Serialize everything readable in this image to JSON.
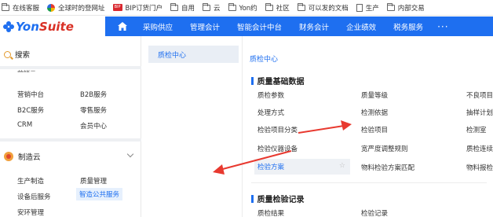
{
  "bookmarks": [
    {
      "label": "在线客服",
      "icon": "folder-icon"
    },
    {
      "label": "全球时的登网址",
      "icon": "pinwheel-icon"
    },
    {
      "label": "BIP订货门户",
      "icon": "bip-icon"
    },
    {
      "label": "自用",
      "icon": "folder-icon"
    },
    {
      "label": "云",
      "icon": "folder-icon"
    },
    {
      "label": "Yon约",
      "icon": "folder-icon"
    },
    {
      "label": "社区",
      "icon": "folder-icon"
    },
    {
      "label": "可以发的文档",
      "icon": "folder-icon"
    },
    {
      "label": "生产",
      "icon": "document-icon"
    },
    {
      "label": "内部交易",
      "icon": "folder-icon"
    }
  ],
  "topnav": {
    "logo_yon": "Yon",
    "logo_suite": "Suite",
    "items": [
      "采购供应",
      "管理会计",
      "智能会计中台",
      "财务会计",
      "企业绩效",
      "税务服务"
    ],
    "more": "···"
  },
  "sidebar": {
    "search_label": "搜索",
    "cutoff_label": "营销云",
    "marketing_items": [
      "营销中台",
      "B2B服务",
      "B2C服务",
      "零售服务",
      "CRM",
      "会员中心"
    ],
    "manufacturing_title": "制造云",
    "manufacturing_items": [
      "生产制造",
      "质量管理",
      "设备后服务",
      "智造公共服务",
      "安环管理"
    ]
  },
  "midcol": {
    "active_item": "质检中心"
  },
  "main": {
    "breadcrumb": "质检中心",
    "section1_title": "质量基础数据",
    "col1": [
      "质检参数",
      "处理方式",
      "检验项目分类",
      "检验仪器设备",
      "检验方案"
    ],
    "col2": [
      "质量等级",
      "检测依据",
      "检验项目",
      "宽严度调整规则",
      "物料检验方案匹配"
    ],
    "col3": [
      "不良项目",
      "抽样计划",
      "检测室",
      "质检连续",
      "物料报检"
    ],
    "section2_title": "质量检验记录",
    "section2_col1": "质检结果",
    "section2_col2": "检验记录",
    "star": "☆"
  },
  "colors": {
    "brand_blue": "#1e6ff0",
    "logo_red": "#d93025",
    "annotation_arrow": "#e8392f"
  }
}
